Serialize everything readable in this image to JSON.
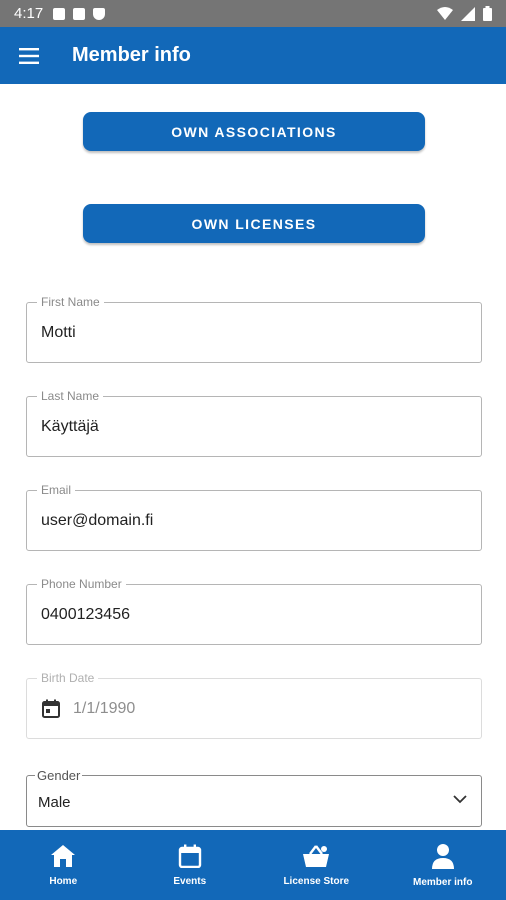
{
  "status_bar": {
    "time": "4:17"
  },
  "app_bar": {
    "title": "Member info"
  },
  "buttons": {
    "own_associations": "OWN ASSOCIATIONS",
    "own_licenses": "OWN LICENSES"
  },
  "form": {
    "first_name": {
      "label": "First Name",
      "value": "Motti"
    },
    "last_name": {
      "label": "Last Name",
      "value": "Käyttäjä"
    },
    "email": {
      "label": "Email",
      "value": "user@domain.fi"
    },
    "phone": {
      "label": "Phone Number",
      "value": "0400123456"
    },
    "birth_date": {
      "label": "Birth Date",
      "value": "1/1/1990"
    },
    "gender": {
      "label": "Gender",
      "value": "Male"
    }
  },
  "bottom_nav": {
    "items": [
      {
        "label": "Home",
        "icon": "home-icon"
      },
      {
        "label": "Events",
        "icon": "calendar-icon"
      },
      {
        "label": "License Store",
        "icon": "basket-icon"
      },
      {
        "label": "Member info",
        "icon": "person-icon"
      }
    ]
  },
  "colors": {
    "primary": "#1268b8",
    "status_bar": "#757575"
  }
}
